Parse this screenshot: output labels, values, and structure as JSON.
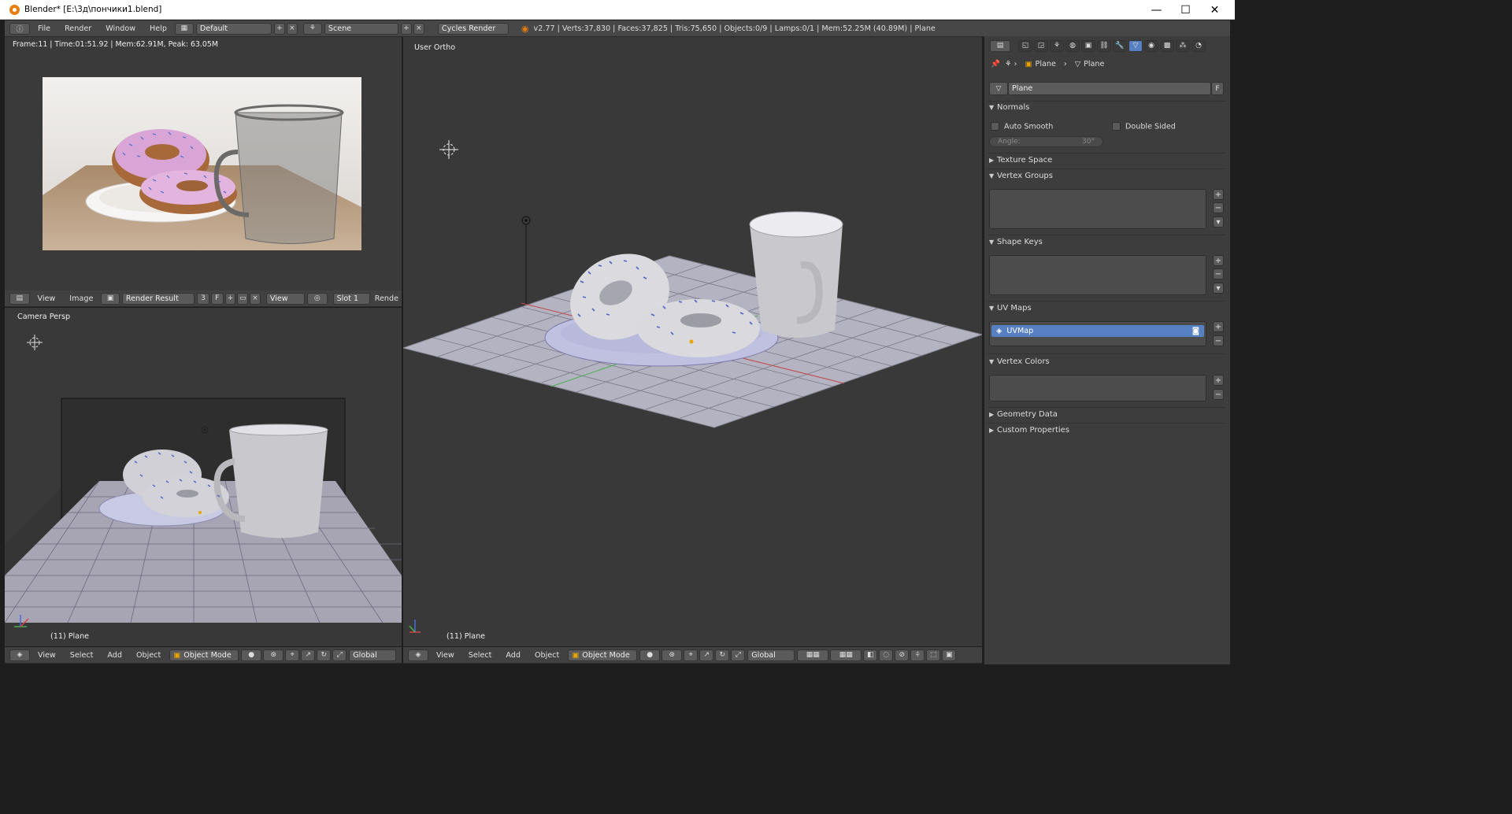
{
  "window": {
    "title": "Blender* [E:\\3д\\пончики1.blend]",
    "minimize": "—",
    "maximize": "☐",
    "close": "✕"
  },
  "info_header": {
    "menus": [
      "File",
      "Render",
      "Window",
      "Help"
    ],
    "layout": "Default",
    "scene": "Scene",
    "engine": "Cycles Render",
    "stats": "v2.77 | Verts:37,830 | Faces:37,825 | Tris:75,650 | Objects:0/9 | Lamps:0/1 | Mem:52.25M (40.89M) | Plane"
  },
  "image_editor": {
    "render_info": "Frame:11 | Time:01:51.92 | Mem:62.91M, Peak: 63.05M",
    "menus": [
      "View",
      "Image"
    ],
    "image_name": "Render Result",
    "users": "3",
    "fake": "F",
    "view_label": "View",
    "slot": "Slot 1",
    "render_label": "Rende"
  },
  "camera_view": {
    "label": "Camera Persp",
    "object_label": "(11) Plane",
    "menus": [
      "View",
      "Select",
      "Add",
      "Object"
    ],
    "mode": "Object Mode",
    "orientation": "Global"
  },
  "main_view": {
    "label": "User Ortho",
    "object_label": "(11) Plane",
    "menus": [
      "View",
      "Select",
      "Add",
      "Object"
    ],
    "mode": "Object Mode",
    "orientation": "Global"
  },
  "properties": {
    "breadcrumb_object": "Plane",
    "breadcrumb_data": "Plane",
    "datablock_name": "Plane",
    "datablock_fake": "F",
    "panels": {
      "normals": "Normals",
      "auto_smooth": "Auto Smooth",
      "double_sided": "Double Sided",
      "angle_label": "Angle:",
      "angle_value": "30°",
      "texture_space": "Texture Space",
      "vertex_groups": "Vertex Groups",
      "shape_keys": "Shape Keys",
      "uv_maps": "UV Maps",
      "uv_map_item": "UVMap",
      "vertex_colors": "Vertex Colors",
      "geometry_data": "Geometry Data",
      "custom_properties": "Custom Properties"
    }
  },
  "colors": {
    "accent_blue": "#5680c2",
    "header": "#414141",
    "viewport": "#393939",
    "sprinkles": "#4a64c8",
    "donut_icing": "#d9a5d6"
  }
}
